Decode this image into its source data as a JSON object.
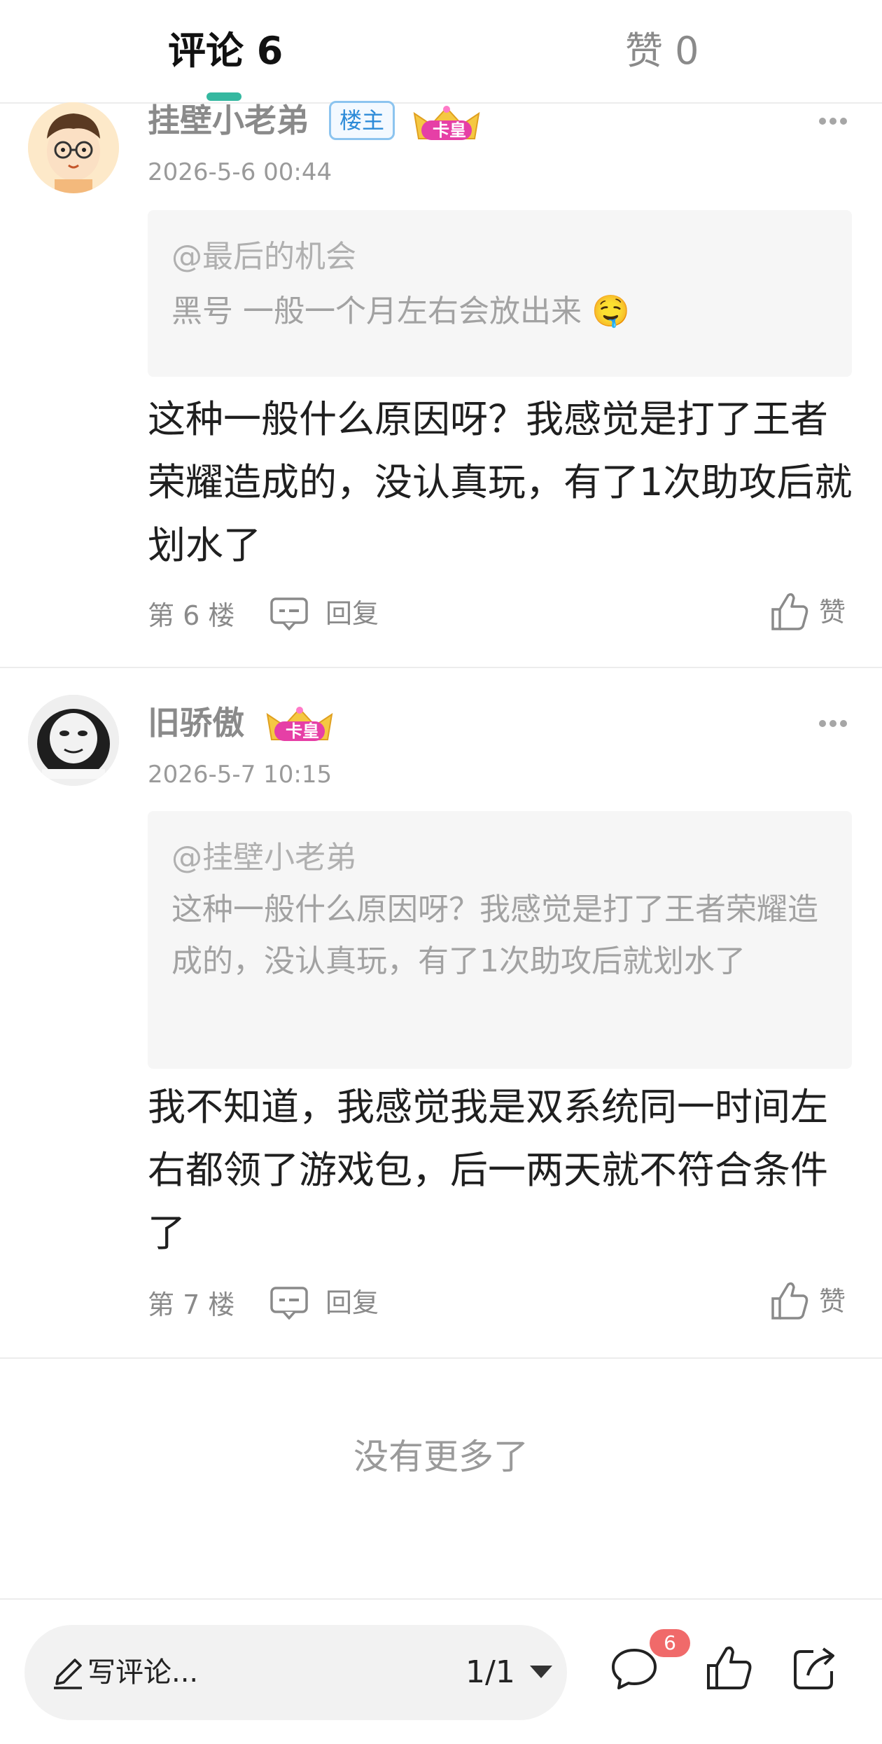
{
  "tabs": {
    "comments": "评论 6",
    "likes": "赞 0"
  },
  "comments": [
    {
      "username": "挂壁小老弟",
      "owner_badge": "楼主",
      "crown_label": "卡皇",
      "timestamp": "2026-5-6 00:44",
      "quote_author": "@最后的机会",
      "quote_text": "黑号 一般一个月左右会放出来 🤤",
      "text": "这种一般什么原因呀？我感觉是打了王者荣耀造成的，没认真玩，有了1次助攻后就划水了",
      "floor": "第 6 楼",
      "reply_label": "回复",
      "like_label": "赞"
    },
    {
      "username": "旧骄傲",
      "crown_label": "卡皇",
      "timestamp": "2026-5-7 10:15",
      "quote_author": "@挂壁小老弟",
      "quote_text": "这种一般什么原因呀？我感觉是打了王者荣耀造成的，没认真玩，有了1次助攻后就划水了",
      "text": "我不知道，我感觉我是双系统同一时间左右都领了游戏包，后一两天就不符合条件了",
      "floor": "第 7 楼",
      "reply_label": "回复",
      "like_label": "赞"
    }
  ],
  "no_more": "没有更多了",
  "bottom_bar": {
    "compose_placeholder": "写评论...",
    "page": "1/1",
    "comment_count_badge": "6"
  },
  "colors": {
    "accent": "#35b8a0",
    "badge_red": "#f06a6a",
    "owner_badge_blue": "#2d8bd8"
  }
}
